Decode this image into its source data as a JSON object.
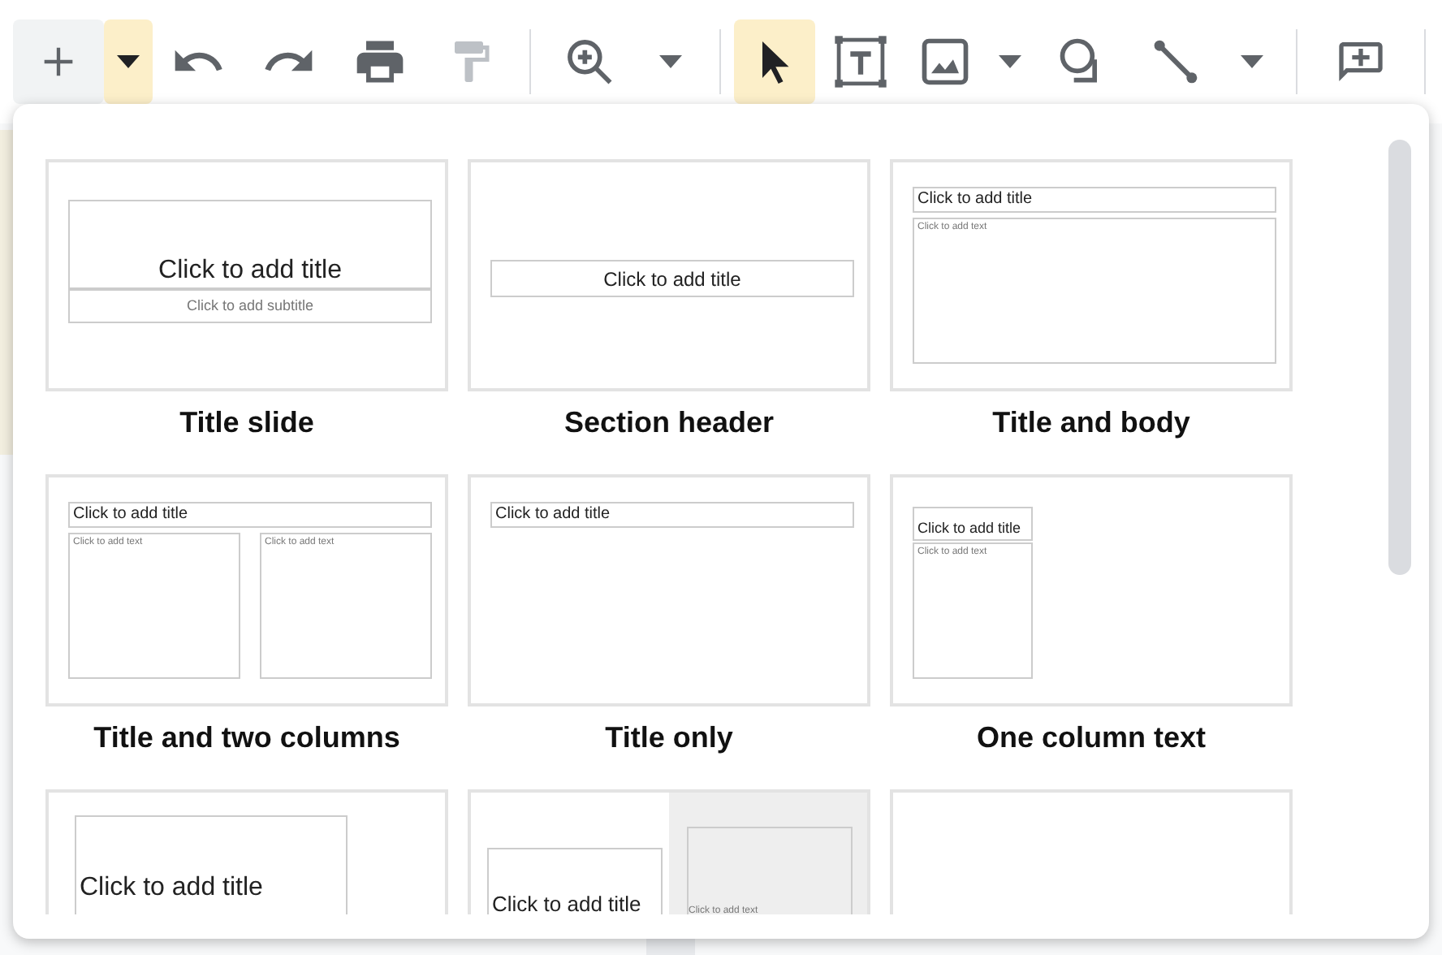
{
  "toolbar": [
    {
      "kind": "button",
      "selected": false,
      "disabled": false,
      "split": true
    },
    {
      "kind": "dropdown",
      "selected": true,
      "disabled": false
    },
    {
      "kind": "button",
      "selected": false,
      "disabled": false
    },
    {
      "kind": "button",
      "selected": false,
      "disabled": false
    },
    {
      "kind": "button",
      "selected": false,
      "disabled": false
    },
    {
      "kind": "button",
      "selected": false,
      "disabled": true
    },
    {
      "kind": "divider"
    },
    {
      "kind": "button",
      "selected": false,
      "disabled": false
    },
    {
      "kind": "dropdown",
      "selected": false,
      "disabled": false
    },
    {
      "kind": "divider"
    },
    {
      "kind": "button",
      "selected": true,
      "disabled": false
    },
    {
      "kind": "button",
      "selected": false,
      "disabled": false
    },
    {
      "kind": "button",
      "selected": false,
      "disabled": false
    },
    {
      "kind": "dropdown",
      "selected": false,
      "disabled": false
    },
    {
      "kind": "button",
      "selected": false,
      "disabled": false
    },
    {
      "kind": "button",
      "selected": false,
      "disabled": false
    },
    {
      "kind": "dropdown",
      "selected": false,
      "disabled": false
    },
    {
      "kind": "divider"
    },
    {
      "kind": "button",
      "selected": false,
      "disabled": false
    },
    {
      "kind": "divider"
    }
  ],
  "layouts": [
    {
      "kind": "title_slide",
      "label": "Title slide",
      "placeholders": [
        {
          "kind": "title",
          "text": "Click to add title"
        },
        {
          "kind": "subtitle",
          "text": "Click to add subtitle"
        }
      ]
    },
    {
      "kind": "section_header",
      "label": "Section header",
      "placeholders": [
        {
          "kind": "title",
          "text": "Click to add title"
        }
      ]
    },
    {
      "kind": "title_body",
      "label": "Title and body",
      "placeholders": [
        {
          "kind": "title",
          "text": "Click to add title"
        },
        {
          "kind": "body",
          "text": "Click to add text"
        }
      ]
    },
    {
      "kind": "two_columns",
      "label": "Title and two columns",
      "placeholders": [
        {
          "kind": "title",
          "text": "Click to add title"
        },
        {
          "kind": "body",
          "text": "Click to add text"
        },
        {
          "kind": "body",
          "text": "Click to add text"
        }
      ]
    },
    {
      "kind": "title_only",
      "label": "Title only",
      "placeholders": [
        {
          "kind": "title",
          "text": "Click to add title"
        }
      ]
    },
    {
      "kind": "one_column",
      "label": "One column text",
      "placeholders": [
        {
          "kind": "title",
          "text": "Click to add title"
        },
        {
          "kind": "body",
          "text": "Click to add text"
        }
      ]
    },
    {
      "kind": "main_point",
      "placeholders": [
        {
          "kind": "title",
          "text": "Click to add title"
        }
      ]
    },
    {
      "kind": "section_description",
      "placeholders": [
        {
          "kind": "title",
          "text": "Click to add title"
        },
        {
          "kind": "body",
          "text": "Click to add text"
        }
      ]
    },
    {
      "kind": "blank"
    }
  ]
}
